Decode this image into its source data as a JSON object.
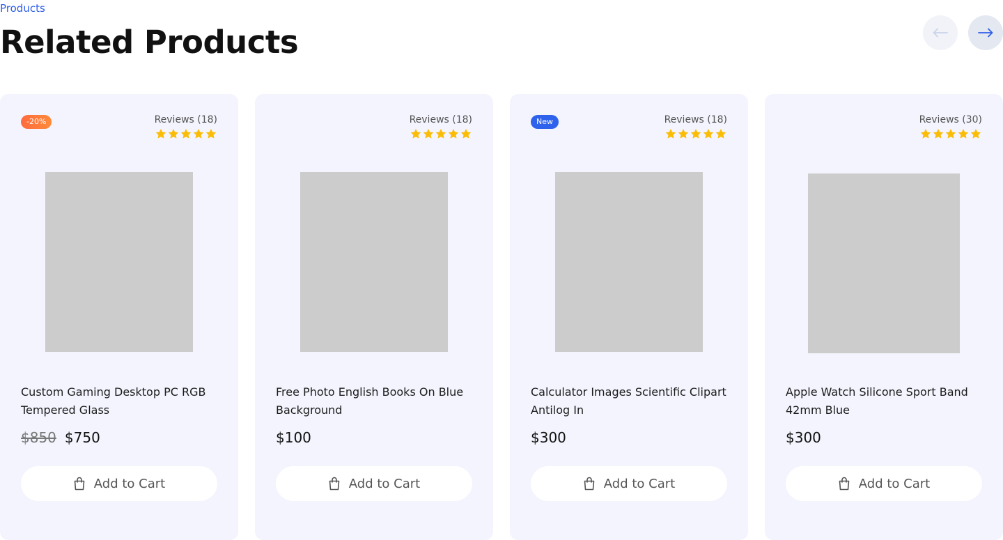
{
  "breadcrumb": "Products",
  "heading": "Related Products",
  "nav": {
    "prev_icon": "arrow-left-icon",
    "next_icon": "arrow-right-icon"
  },
  "colors": {
    "accent": "#2f5fe8",
    "star": "#fbbc05",
    "card_bg": "#f3f4fd",
    "sale_badge": "#ff7a3d",
    "new_badge": "#2e62ed"
  },
  "products": [
    {
      "badge": "-20%",
      "badge_type": "sale",
      "reviews": "Reviews (18)",
      "rating": 5,
      "name": "Custom Gaming Desktop PC RGB Tempered Glass",
      "old_price": "$850",
      "price": "$750",
      "cart_label": "Add to Cart"
    },
    {
      "badge": "",
      "badge_type": "",
      "reviews": "Reviews (18)",
      "rating": 5,
      "name": "Free Photo English Books On Blue Background",
      "old_price": "",
      "price": "$100",
      "cart_label": "Add to Cart"
    },
    {
      "badge": "New",
      "badge_type": "new",
      "reviews": "Reviews (18)",
      "rating": 5,
      "name": "Calculator Images Scientific Clipart Antilog In",
      "old_price": "",
      "price": "$300",
      "cart_label": "Add to Cart"
    },
    {
      "badge": "",
      "badge_type": "",
      "reviews": "Reviews (30)",
      "rating": 5,
      "name": "Apple Watch Silicone Sport Band 42mm Blue",
      "old_price": "",
      "price": "$300",
      "cart_label": "Add to Cart"
    }
  ]
}
